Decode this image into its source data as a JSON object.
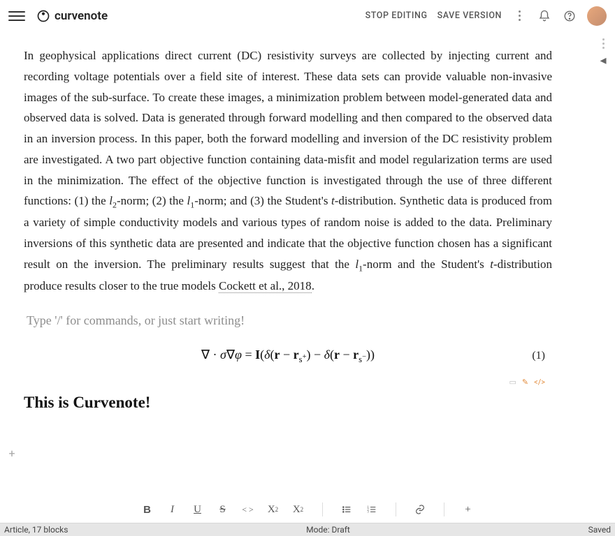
{
  "header": {
    "logo_text": "curvenote",
    "stop_editing": "STOP EDITING",
    "save_version": "SAVE VERSION"
  },
  "article": {
    "paragraph_html": "In geophysical applications direct current (DC) resistivity surveys are collected by injecting current and recording voltage potentials over a field site of interest. These data sets can provide valuable non-invasive images of the sub-surface. To create these images, a minimization problem between model-generated data and observed data is solved. Data is generated through forward modelling and then compared to the observed data in an inversion process. In this paper, both the forward modelling and inversion of the DC resistivity problem are investigated. A two part objective function containing data-misfit and model regularization terms are used in the minimization. The effect of the objective function is investigated through the use of three different functions: (1) the <span class=\"math-it\">l</span><sub>2</sub>-norm; (2) the <span class=\"math-it\">l</span><sub>1</sub>-norm; and (3) the Student's <span class=\"math-it\">t</span>-distribution. Synthetic data is produced from a variety of simple conductivity models and various types of random noise is added to the data. Preliminary inversions of this synthetic data are presented and indicate that the objective function chosen has a significant result on the inversion. The preliminary results suggest that the <span class=\"math-it\">l</span><sub>1</sub>-norm and the Student's <span class=\"math-it\">t</span>-distribution produce results closer to the true models <span class=\"citation\">Cockett et al., 2018</span>.",
    "placeholder": "Type '/' for commands, or just start writing!",
    "equation_html": "∇ · <span class=\"math-it\">σ</span>∇<span class=\"math-it\">φ</span> = <b>I</b>(<span class=\"math-it\">δ</span>(<b>r</b> − <b>r</b><sub>s<sup>+</sup></sub>) − <span class=\"math-it\">δ</span>(<b>r</b> − <b>r</b><sub>s<sup>−</sup></sub>))",
    "equation_number": "(1)",
    "heading": "This is Curvenote!"
  },
  "toolbar": {
    "bold": "B",
    "italic": "I",
    "underline": "U",
    "strike": "S",
    "code": "< >",
    "sub": "X",
    "sup": "X",
    "plus": "+"
  },
  "status": {
    "left": "Article, 17 blocks",
    "center": "Mode: Draft",
    "right": "Saved"
  }
}
